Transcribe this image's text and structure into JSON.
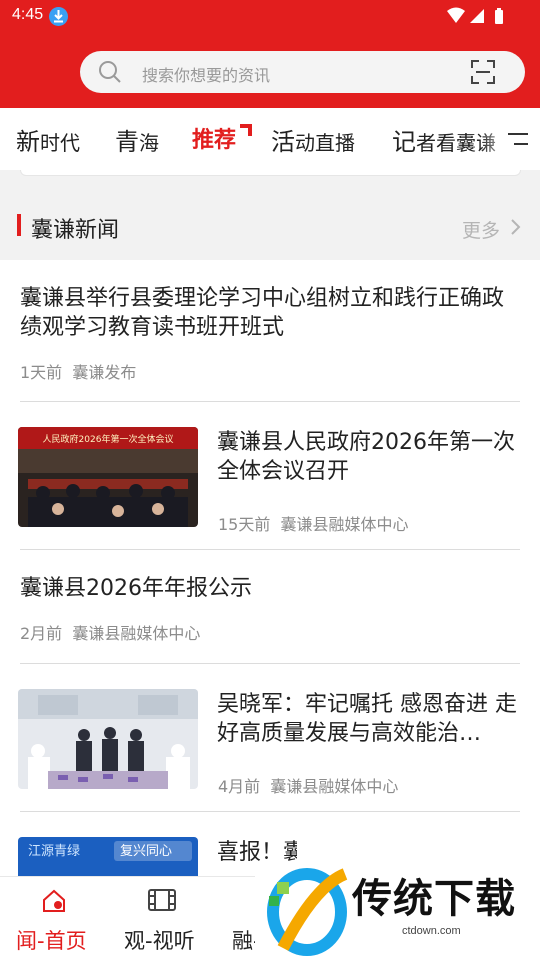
{
  "status": {
    "time": "4:45"
  },
  "search": {
    "placeholder": "搜索你想要的资讯"
  },
  "tabs": [
    {
      "big": "新",
      "small": "时代"
    },
    {
      "big": "青",
      "small": "海"
    },
    {
      "big": "推",
      "small": "荐"
    },
    {
      "big": "活",
      "small": "动直播"
    },
    {
      "big": "记",
      "small": "者看囊谦"
    }
  ],
  "section": {
    "title": "囊谦新闻",
    "more": "更多"
  },
  "news": [
    {
      "title": "囊谦县举行县委理论学习中心组树立和践行正确政绩观学习教育读书班开班式",
      "time": "1天前",
      "source": "囊谦发布"
    },
    {
      "title": "囊谦县人民政府2026年第一次全体会议召开",
      "time": "15天前",
      "source": "囊谦县融媒体中心",
      "thumb_banner": "人民政府2026年第一次全体会议"
    },
    {
      "title": "囊谦县2026年年报公示",
      "time": "2月前",
      "source": "囊谦县融媒体中心"
    },
    {
      "title": "吴晓军：牢记嘱托 感恩奋进 走好高质量发展与高效能治…",
      "time": "4月前",
      "source": "囊谦县融媒体中心"
    },
    {
      "title": "喜报！囊谦县在全州青少年...",
      "thumb_text_a": "江源青绿",
      "thumb_text_b": "复兴同心"
    }
  ],
  "bottom_nav": [
    {
      "label": "闻-首页"
    },
    {
      "label": "观-视听"
    },
    {
      "label": "融-"
    }
  ],
  "watermark": {
    "text": "传统下载",
    "url": "ctdown.com"
  },
  "colors": {
    "brand_red": "#e21e1e",
    "text": "#222222",
    "meta": "#8c8c8c"
  }
}
